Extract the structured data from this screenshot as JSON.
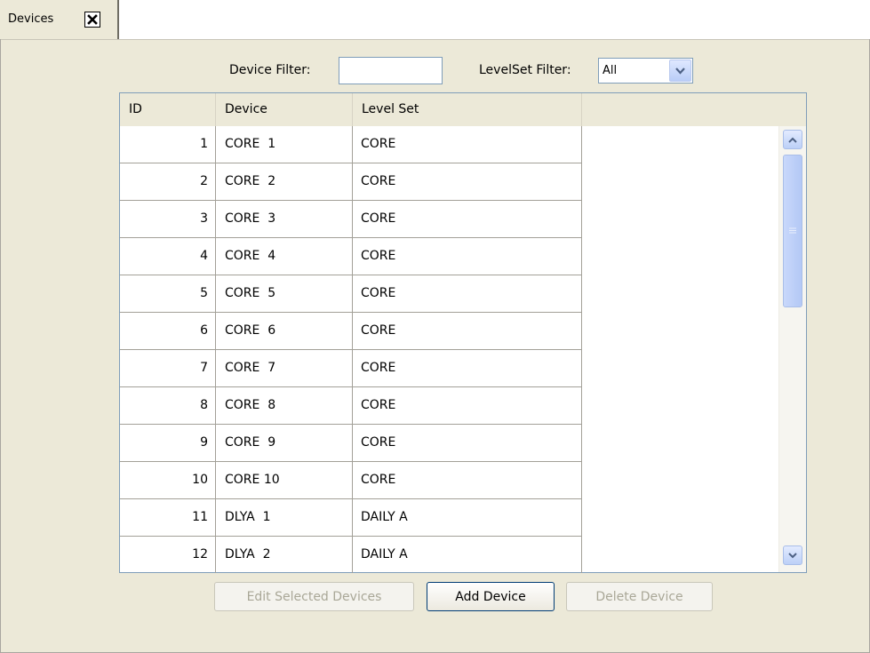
{
  "tab": {
    "label": "Devices",
    "close_icon": "close-icon"
  },
  "filters": {
    "device_filter_label": "Device Filter:",
    "device_filter_value": "",
    "levelset_filter_label": "LevelSet Filter:",
    "levelset_filter_value": "All"
  },
  "table": {
    "columns": [
      "ID",
      "Device",
      "Level Set"
    ],
    "rows": [
      {
        "id": "1",
        "device": "CORE  1",
        "level_set": "CORE"
      },
      {
        "id": "2",
        "device": "CORE  2",
        "level_set": "CORE"
      },
      {
        "id": "3",
        "device": "CORE  3",
        "level_set": "CORE"
      },
      {
        "id": "4",
        "device": "CORE  4",
        "level_set": "CORE"
      },
      {
        "id": "5",
        "device": "CORE  5",
        "level_set": "CORE"
      },
      {
        "id": "6",
        "device": "CORE  6",
        "level_set": "CORE"
      },
      {
        "id": "7",
        "device": "CORE  7",
        "level_set": "CORE"
      },
      {
        "id": "8",
        "device": "CORE  8",
        "level_set": "CORE"
      },
      {
        "id": "9",
        "device": "CORE  9",
        "level_set": "CORE"
      },
      {
        "id": "10",
        "device": "CORE 10",
        "level_set": "CORE"
      },
      {
        "id": "11",
        "device": "DLYA  1",
        "level_set": "DAILY A"
      },
      {
        "id": "12",
        "device": "DLYA  2",
        "level_set": "DAILY A"
      }
    ]
  },
  "buttons": {
    "edit_selected": "Edit Selected Devices",
    "add_device": "Add Device",
    "delete_device": "Delete Device"
  },
  "colors": {
    "panel_bg": "#ece9d8",
    "border_blue": "#7f9db9",
    "disabled_text": "#a9a797"
  }
}
